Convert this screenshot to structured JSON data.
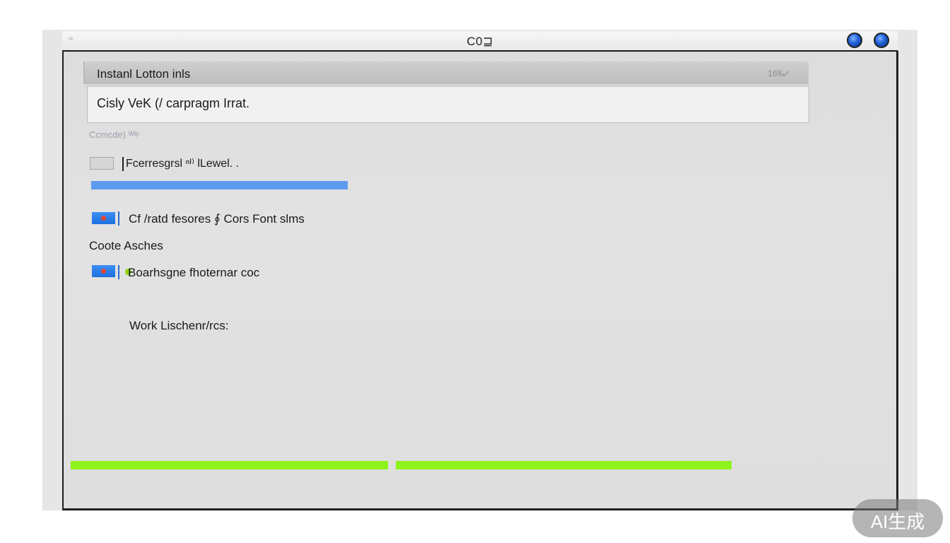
{
  "window": {
    "title": "C0⊒",
    "menu_glyph": "⌯"
  },
  "section": {
    "header_label": "Instanl Lotton inls",
    "header_meta": "16‰ⁿ",
    "input_value": "Cisly VeK (/ carpragm Irrat.",
    "hint": "Ccmcde) ᵂᴵᵖ"
  },
  "row_level": {
    "label": "Fcerresgrsl ⁿᴵ⁾ lLewel. .",
    "progress": 1.0
  },
  "row_features": {
    "label": "Cf /ratd fesores ∮ Cors Font slms"
  },
  "heading_archives": "Coote Asches",
  "row_recovery": {
    "label": "Boarhsgne fhoternar coc"
  },
  "work_label": "Work Lischenr/rcs:",
  "watermark": "AI生成",
  "colors": {
    "accent_blue": "#5e9bef",
    "accent_green": "#8ff21a",
    "titlebar_buttons": "#1f5fd6"
  },
  "icons": [
    "menu-glyph-icon",
    "window-button-icon",
    "flag-icon",
    "cursor-icon",
    "status-dot-icon"
  ]
}
